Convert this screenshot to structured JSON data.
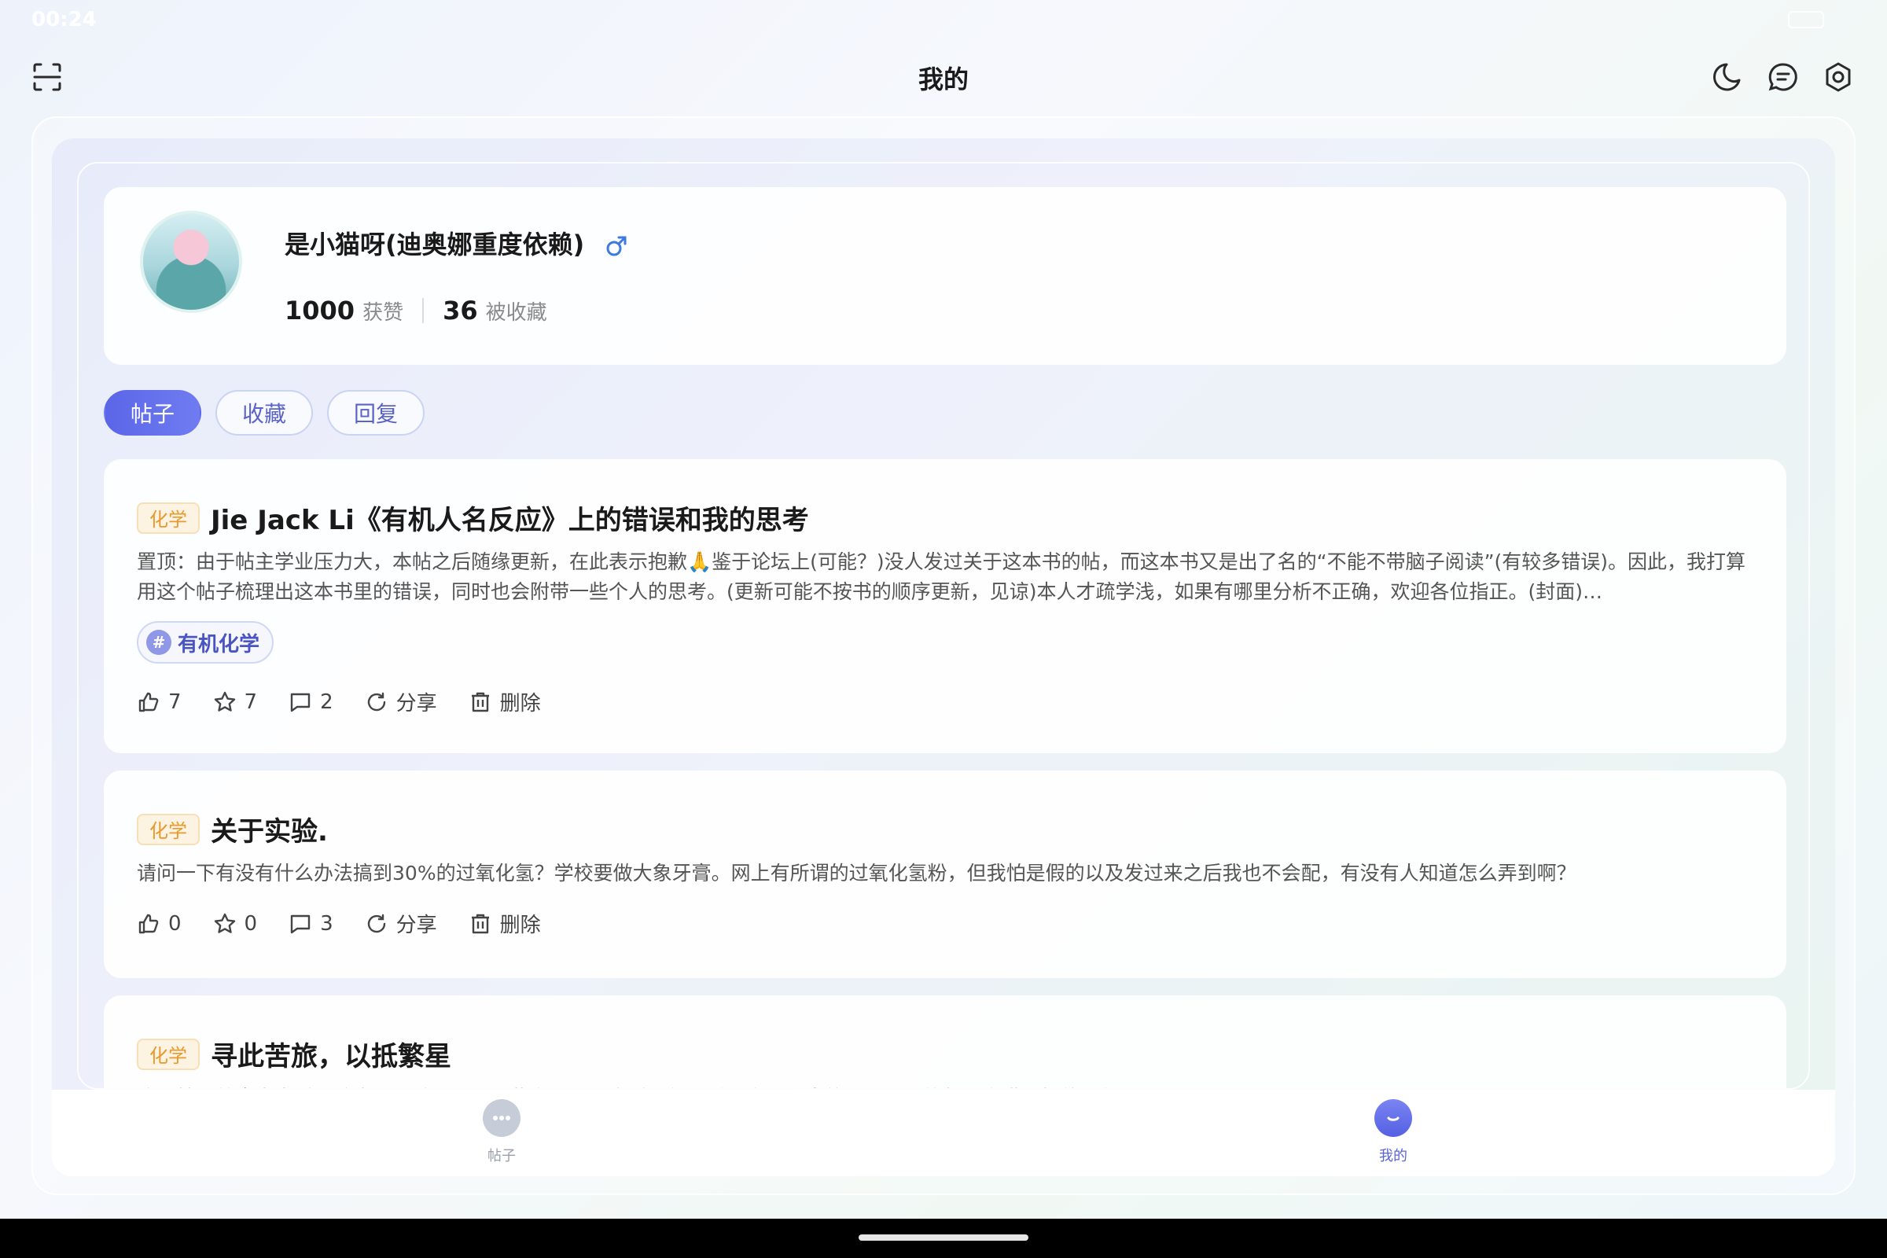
{
  "status_bar": {
    "time": "00:24"
  },
  "header": {
    "title": "我的"
  },
  "profile": {
    "name": "是小猫呀(迪奥娜重度依赖)",
    "likes_count": "1000",
    "likes_label": "获赞",
    "favorited_count": "36",
    "favorited_label": "被收藏"
  },
  "tabs": [
    {
      "label": "帖子",
      "active": true
    },
    {
      "label": "收藏",
      "active": false
    },
    {
      "label": "回复",
      "active": false
    }
  ],
  "posts": [
    {
      "subject": "化学",
      "title": "Jie Jack Li《有机人名反应》上的错误和我的思考",
      "body": "置顶：由于帖主学业压力大，本帖之后随缘更新，在此表示抱歉🙏鉴于论坛上(可能？)没人发过关于这本书的帖，而这本书又是出了名的“不能不带脑子阅读”(有较多错误)。因此，我打算用这个帖子梳理出这本书里的错误，同时也会附带一些个人的思考。(更新可能不按书的顺序更新，见谅)本人才疏学浅，如果有哪里分析不正确，欢迎各位指正。(封面)…",
      "topic": "有机化学",
      "likes": "7",
      "stars": "7",
      "comments": "2",
      "share_label": "分享",
      "delete_label": "删除"
    },
    {
      "subject": "化学",
      "title": "关于实验.",
      "body": "请问一下有没有什么办法搞到30%的过氧化氢？学校要做大象牙膏。网上有所谓的过氧化氢粉，但我怕是假的以及发过来之后我也不会配，有没有人知道怎么弄到啊？",
      "likes": "0",
      "stars": "0",
      "comments": "3",
      "share_label": "分享",
      "delete_label": "删除"
    },
    {
      "subject": "化学",
      "title": "寻此苦旅，以抵繁星",
      "body": "这个帖子就拿来当时间胶囊了，随便记录一些东西，不定时更新，希望之后上岸的那天，还能想起充满回忆的要年"
    }
  ],
  "bottom_nav": [
    {
      "label": "帖子",
      "active": false
    },
    {
      "label": "我的",
      "active": true
    }
  ],
  "colors": {
    "accent": "#5b66e8",
    "badge_text": "#e89a2c",
    "badge_bg": "#fdf3e2",
    "topic_text": "#4b55c2"
  }
}
